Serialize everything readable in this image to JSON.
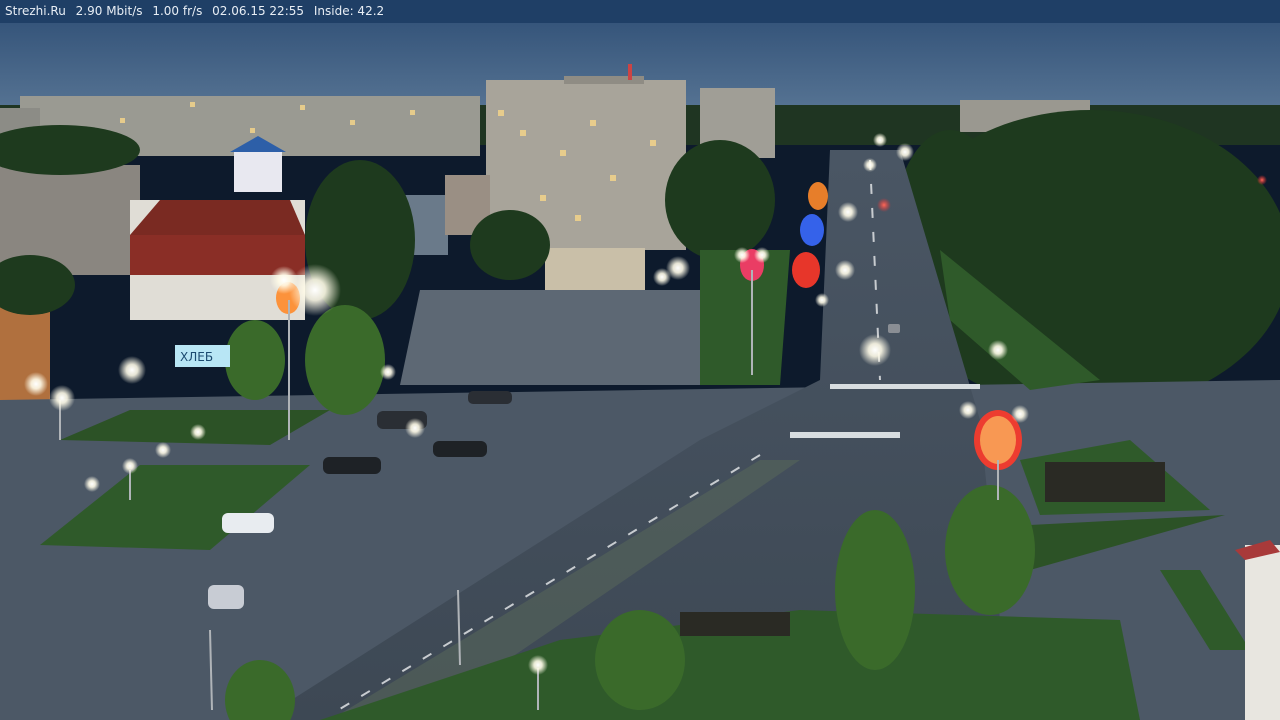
{
  "overlay": {
    "site": "Strezhi.Ru",
    "bitrate": "2.90 Mbit/s",
    "framerate": "1.00 fr/s",
    "datetime": "02.06.15 22:55",
    "inside": "Inside: 42.2"
  },
  "scene": {
    "store_sign": "ХЛЕБ",
    "colors": {
      "sky_top": "#3a5b82",
      "sky_bottom": "#5a7796",
      "asphalt": "#4a5664",
      "grass": "#2f5a2a",
      "trees": "#1e3a1e",
      "lamp": "#fff6e8"
    }
  }
}
